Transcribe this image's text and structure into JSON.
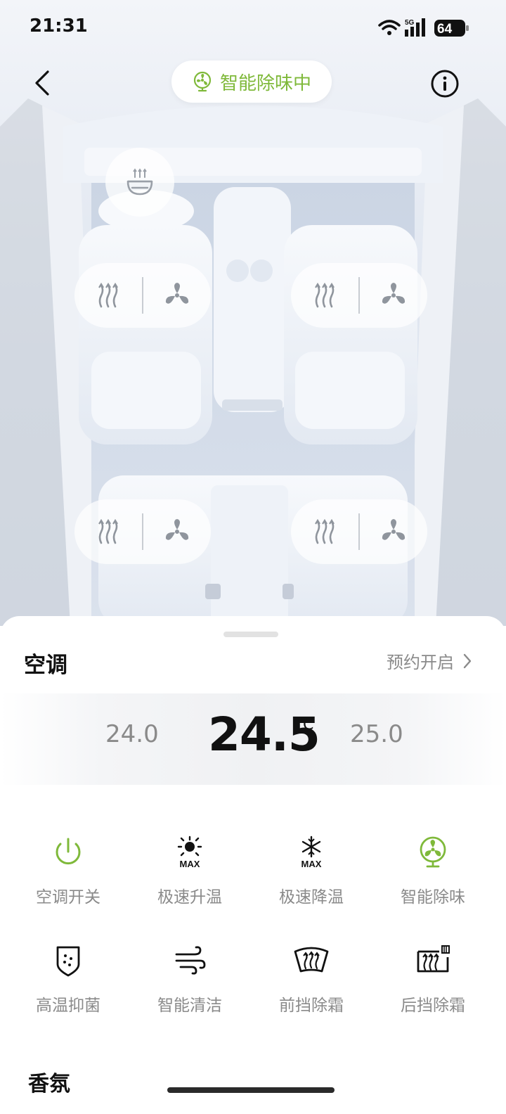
{
  "status_bar": {
    "time": "21:31",
    "network": "5G",
    "battery": "64"
  },
  "header": {
    "mode_label": "智能除味中",
    "icons": [
      "back-arrow-icon",
      "fan-icon",
      "info-icon"
    ]
  },
  "car": {
    "steering_heat_icon": "steering-wheel-heat-icon",
    "seats": [
      {
        "id": "front-left",
        "icons": [
          "seat-heat-icon",
          "seat-fan-icon"
        ]
      },
      {
        "id": "front-right",
        "icons": [
          "seat-heat-icon",
          "seat-fan-icon"
        ]
      },
      {
        "id": "rear-left",
        "icons": [
          "seat-heat-icon",
          "seat-fan-icon"
        ]
      },
      {
        "id": "rear-right",
        "icons": [
          "seat-heat-icon",
          "seat-fan-icon"
        ]
      }
    ]
  },
  "panel": {
    "title": "空调",
    "schedule_label": "预约开启",
    "next_section_title": "香氛"
  },
  "temperature": {
    "lower": "24.0",
    "current": "24.5",
    "unit": "℃",
    "higher": "25.0"
  },
  "functions": [
    {
      "label": "空调开关",
      "icon": "power-icon",
      "active": true
    },
    {
      "label": "极速升温",
      "icon": "sun-max-icon",
      "active": false
    },
    {
      "label": "极速降温",
      "icon": "snowflake-max-icon",
      "active": false
    },
    {
      "label": "智能除味",
      "icon": "fan-deodorize-icon",
      "active": true
    },
    {
      "label": "高温抑菌",
      "icon": "sterilize-shield-icon",
      "active": false
    },
    {
      "label": "智能清洁",
      "icon": "wind-clean-icon",
      "active": false
    },
    {
      "label": "前挡除霜",
      "icon": "front-defrost-icon",
      "active": false
    },
    {
      "label": "后挡除霜",
      "icon": "rear-defrost-icon",
      "active": false
    }
  ],
  "colors": {
    "accent_green": "#7fb93a",
    "text_gray": "#8a8a8a",
    "text_dark": "#111111"
  }
}
